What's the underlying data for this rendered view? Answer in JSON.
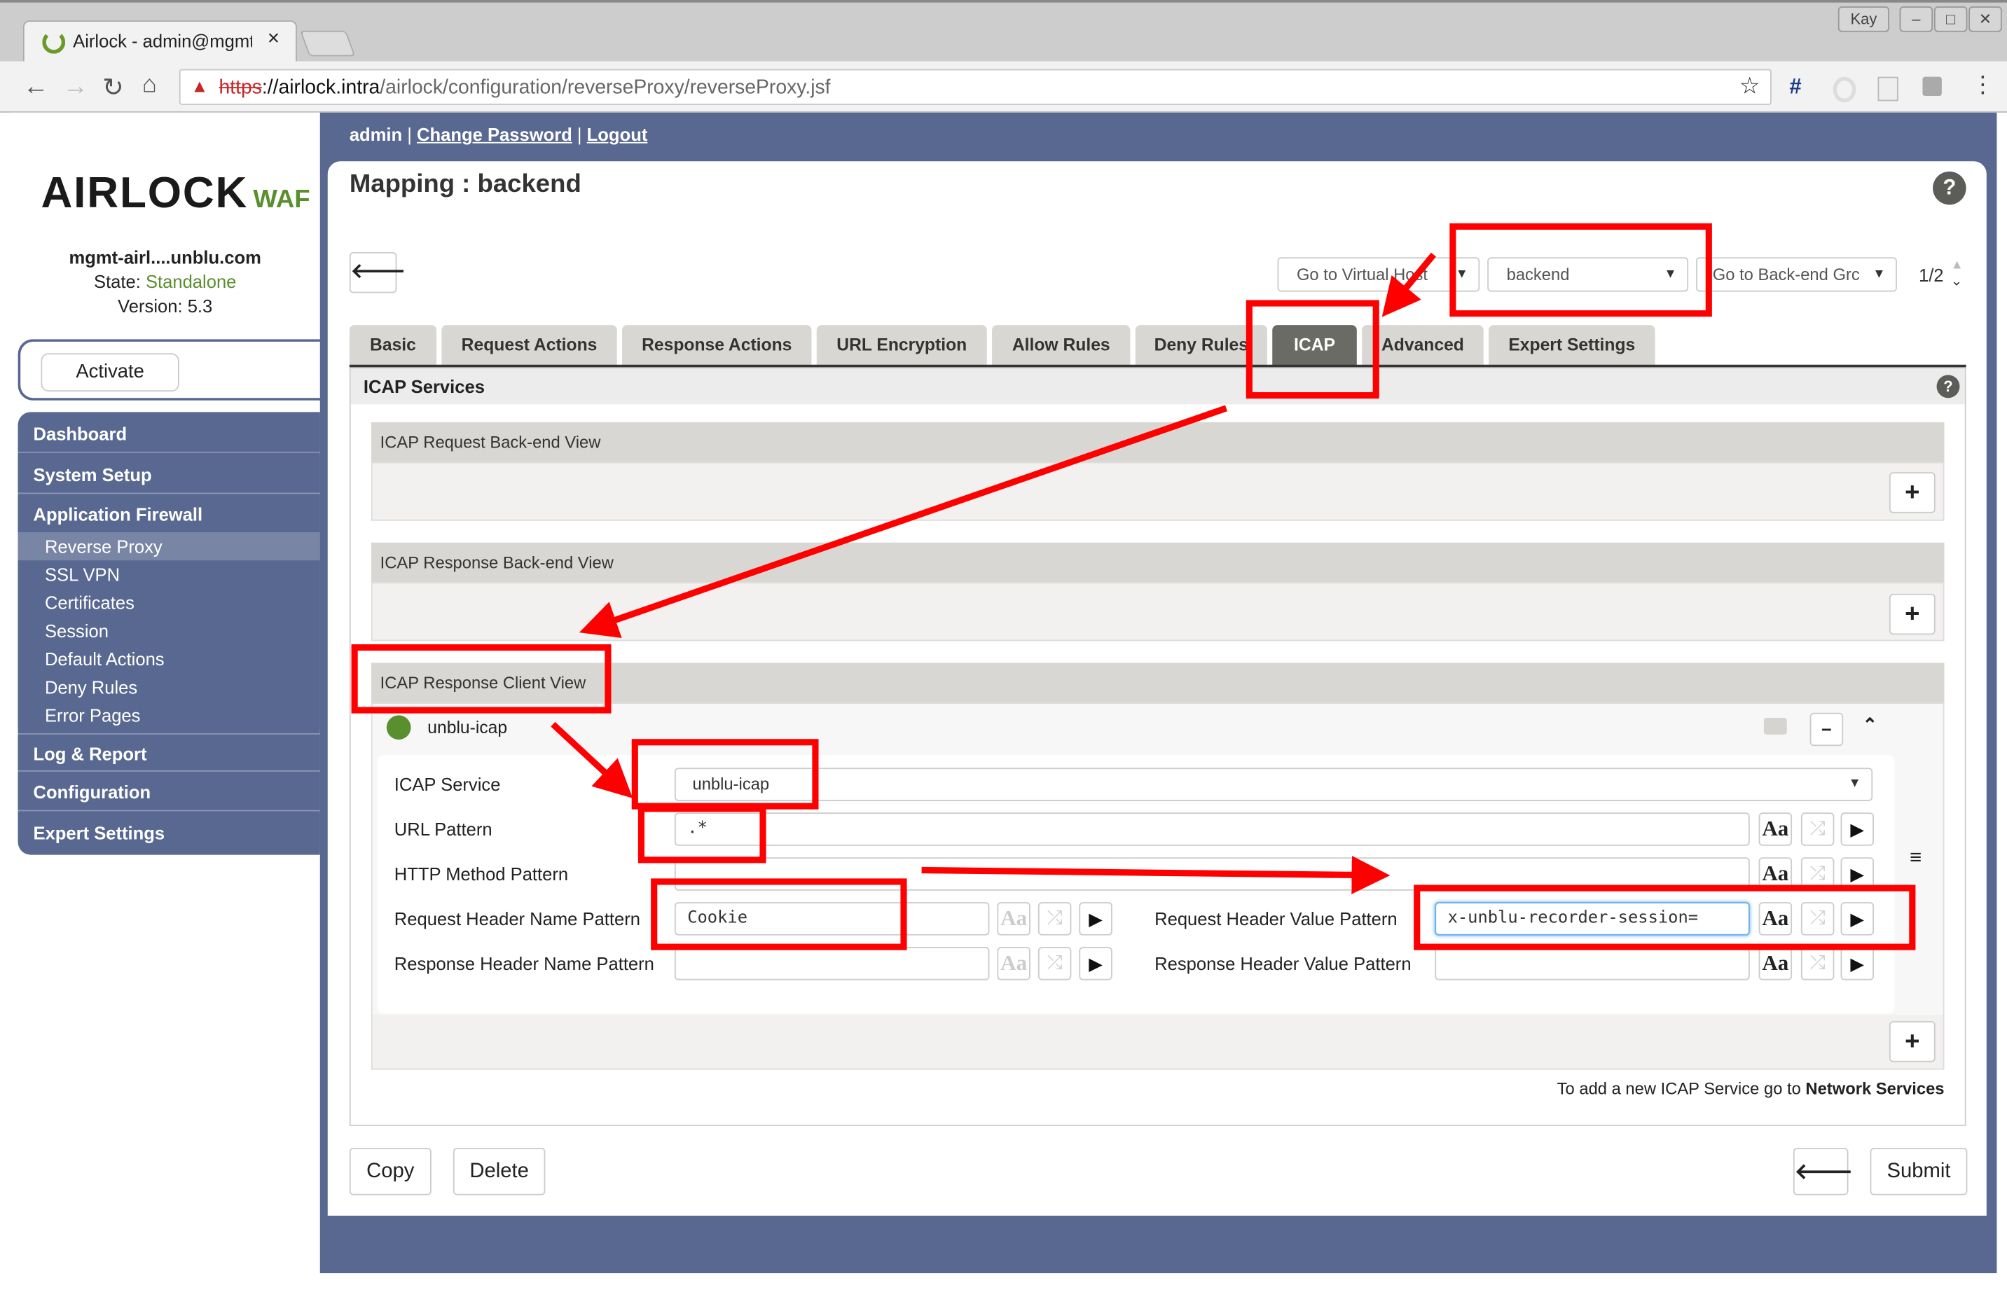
{
  "browser": {
    "tab_title": "Airlock - admin@mgmt",
    "tab_close": "×",
    "user_badge": "Kay",
    "url_scheme": "https",
    "url_host": "://airlock.intra",
    "url_path": "/airlock/configuration/reverseProxy/reverseProxy.jsf",
    "ext_hash": "#"
  },
  "header": {
    "user": "admin",
    "sep": "|",
    "change_password": "Change Password",
    "logout": "Logout"
  },
  "sidebar": {
    "logo_main": "AIRLOCK",
    "logo_sub": "WAF",
    "host": "mgmt-airl....unblu.com",
    "state_label": "State: ",
    "state_value": "Standalone",
    "version": "Version: 5.3",
    "activate": "Activate",
    "nav": [
      {
        "label": "Dashboard"
      },
      {
        "label": "System Setup"
      },
      {
        "label": "Application Firewall"
      }
    ],
    "sub": [
      {
        "label": "Reverse Proxy"
      },
      {
        "label": "SSL VPN"
      },
      {
        "label": "Certificates"
      },
      {
        "label": "Session"
      },
      {
        "label": "Default Actions"
      },
      {
        "label": "Deny Rules"
      },
      {
        "label": "Error Pages"
      }
    ],
    "nav2": [
      {
        "label": "Log & Report"
      },
      {
        "label": "Configuration"
      },
      {
        "label": "Expert Settings"
      }
    ]
  },
  "main": {
    "title": "Mapping : backend",
    "help": "?",
    "goto_vhost": "Go to Virtual Host",
    "mapping_select": "backend",
    "goto_backend": "Go to Back-end Grc",
    "pager": "1/2",
    "tabs": [
      {
        "label": "Basic"
      },
      {
        "label": "Request Actions"
      },
      {
        "label": "Response Actions"
      },
      {
        "label": "URL Encryption"
      },
      {
        "label": "Allow Rules"
      },
      {
        "label": "Deny Rules"
      },
      {
        "label": "ICAP"
      },
      {
        "label": "Advanced"
      },
      {
        "label": "Expert Settings"
      }
    ],
    "active_tab": "ICAP",
    "section_title": "ICAP Services",
    "views": {
      "request_backend": "ICAP Request Back-end View",
      "response_backend": "ICAP Response Back-end View",
      "response_client": "ICAP Response Client View"
    },
    "entry": {
      "name": "unblu-icap",
      "status_color": "#5a8f2e",
      "icap_service_label": "ICAP Service",
      "icap_service_value": "unblu-icap",
      "url_pattern_label": "URL Pattern",
      "url_pattern_value": ".*",
      "http_method_label": "HTTP Method Pattern",
      "http_method_value": "",
      "req_header_name_label": "Request Header Name Pattern",
      "req_header_name_value": "Cookie",
      "req_header_value_label": "Request Header Value Pattern",
      "req_header_value_value": "x-unblu-recorder-session=",
      "resp_header_name_label": "Response Header Name Pattern",
      "resp_header_name_value": "",
      "resp_header_value_label": "Response Header Value Pattern",
      "resp_header_value_value": "",
      "case_label": "Aa"
    },
    "footnote": "To add a new ICAP Service go to ",
    "footnote_link": "Network Services",
    "copy": "Copy",
    "delete": "Delete",
    "submit": "Submit"
  },
  "annotation_color": "#ff0000"
}
